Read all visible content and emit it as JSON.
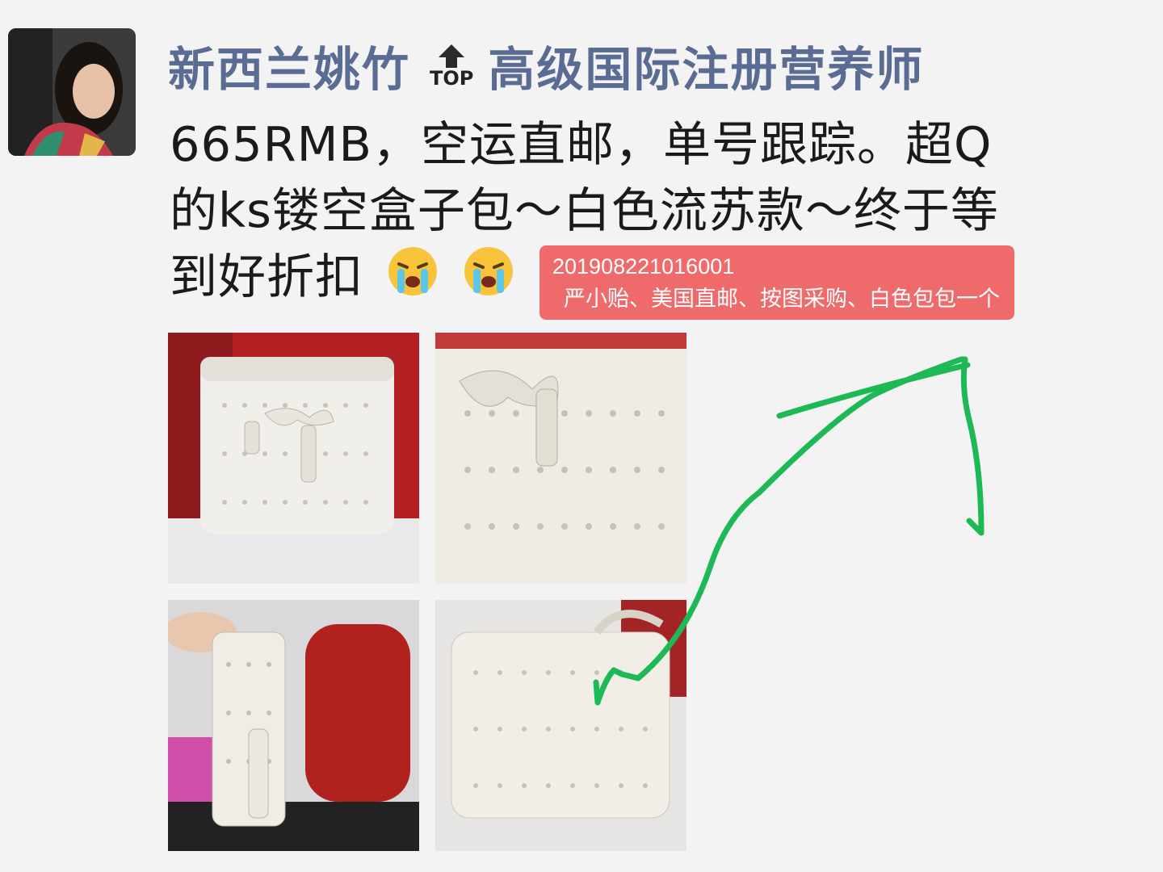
{
  "post": {
    "author": "新西兰姚竹",
    "top_badge": "TOP",
    "author_title": "高级国际注册营养师",
    "text_line1": "665RMB，空运直邮，单号跟踪。超Q",
    "text_line2": "的ks镂空盒子包～白色流苏款～终于等",
    "text_line3": "到好折扣",
    "emoji": [
      "crying-face",
      "crying-face"
    ]
  },
  "photos": [
    "white-bag-front",
    "white-bag-closeup",
    "white-bag-side-held",
    "white-bag-back"
  ],
  "order_sticker": {
    "order_id": "201908221016001",
    "note": "严小贻、美国直邮、按图采购、白色包包一个"
  },
  "colors": {
    "username": "#5a6b94",
    "sticker_bg": "#ef6b6b",
    "annotation": "#1db954"
  }
}
